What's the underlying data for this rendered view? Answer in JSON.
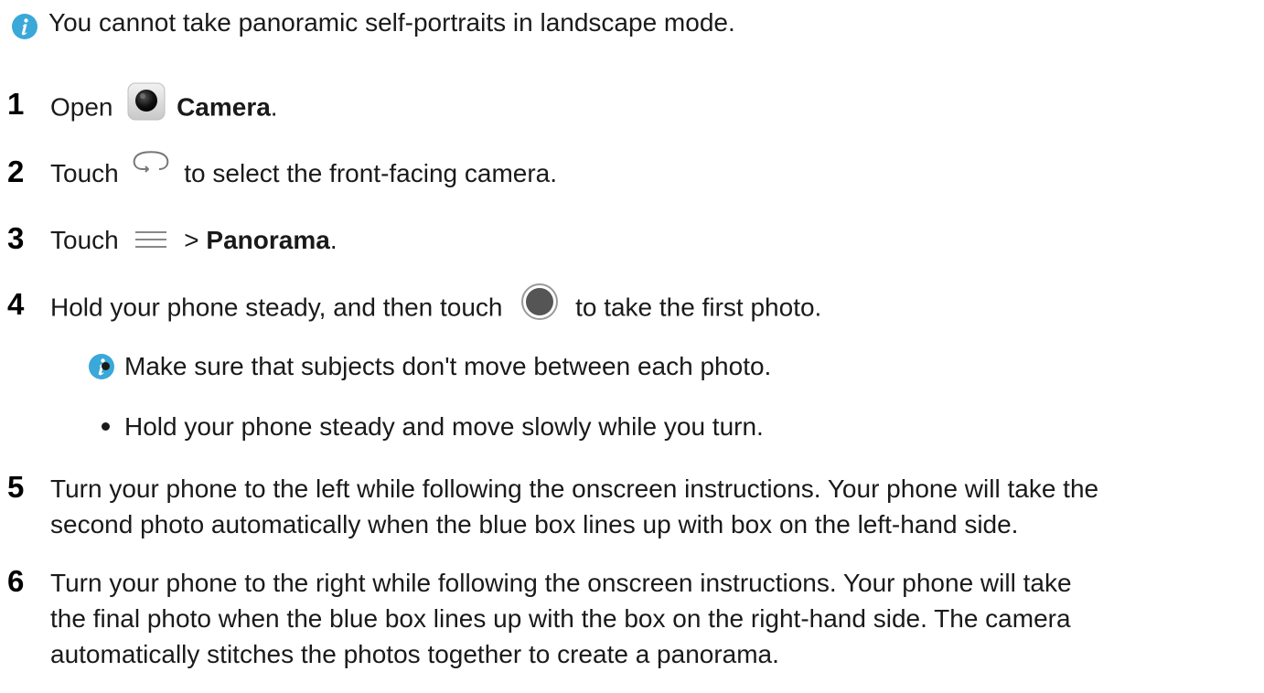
{
  "top_note": {
    "icon": "info-icon",
    "text": "You cannot take panoramic self-portraits in landscape mode."
  },
  "steps": [
    {
      "number": "1",
      "prefix": "Open",
      "icon": "camera-app-icon",
      "bold": "Camera",
      "suffix": "."
    },
    {
      "number": "2",
      "prefix": "Touch",
      "icon": "switch-camera-icon",
      "suffix": "to select the front-facing camera."
    },
    {
      "number": "3",
      "prefix": "Touch",
      "icon": "menu-icon",
      "middle": ">",
      "bold": "Panorama",
      "suffix": "."
    },
    {
      "number": "4",
      "prefix": "Hold your phone steady, and then touch",
      "icon": "shutter-icon",
      "suffix": "to take the first photo."
    },
    {
      "number": "5",
      "line1": "Turn your phone to the left while following the onscreen instructions. Your phone will take the",
      "line2": "second photo automatically when the blue box lines up with box on the left-hand side."
    },
    {
      "number": "6",
      "line1": "Turn your phone to the right while following the onscreen instructions. Your phone will take",
      "line2": "the final photo when the blue box lines up with the box on the right-hand side. The camera",
      "line3": "automatically stitches the photos together to create a panorama."
    }
  ],
  "step4_note": {
    "icon": "info-icon",
    "bullets": [
      "Make sure that subjects don't move between each photo.",
      "Hold your phone steady and move slowly while you turn."
    ]
  },
  "colors": {
    "info_icon": "#3aa8d8",
    "text": "#1a1a1a"
  }
}
